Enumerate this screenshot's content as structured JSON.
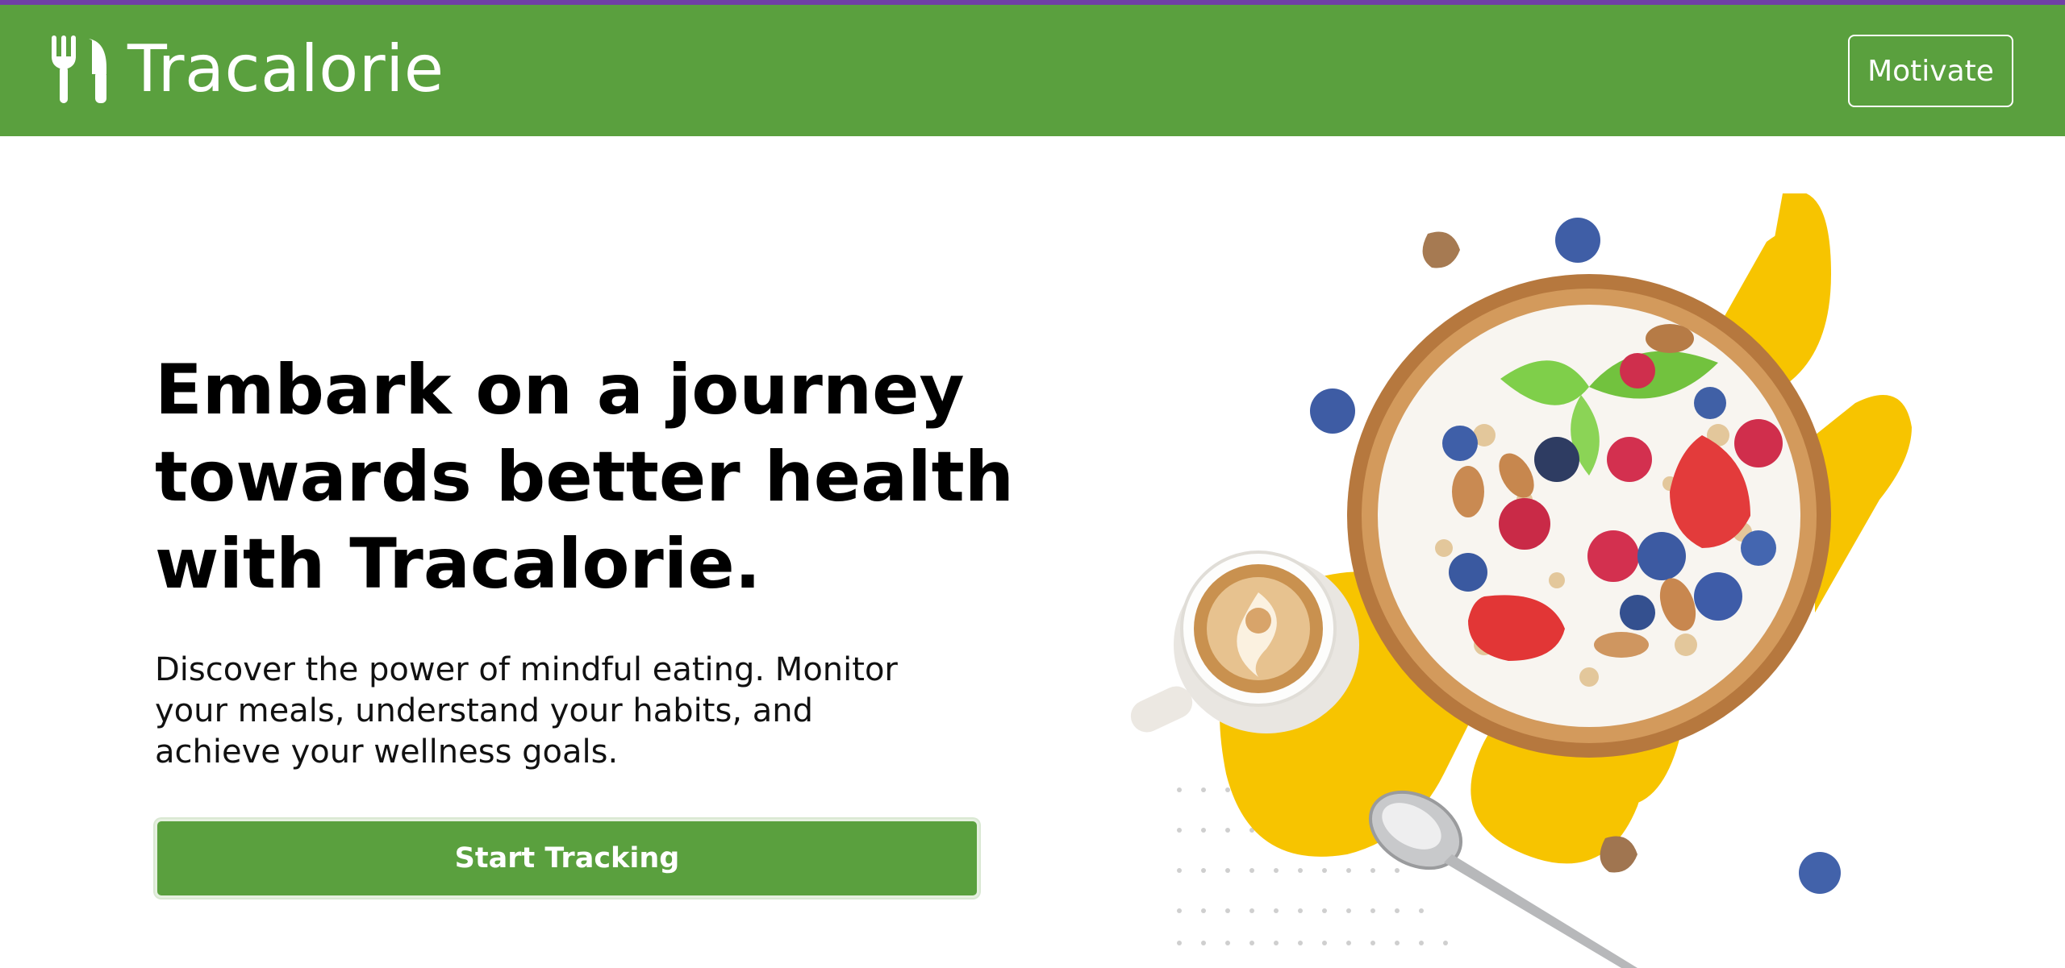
{
  "header": {
    "brand_name": "Tracalorie",
    "logo_icon": "utensils-icon",
    "motivate_label": "Motivate"
  },
  "hero": {
    "title_lines": [
      "Embark on a journey",
      "towards better health",
      "with Tracalorie."
    ],
    "subtitle_lines": [
      "Discover the power of mindful eating. Monitor",
      "your meals, understand your habits, and",
      "achieve your wellness goals."
    ],
    "cta_label": "Start Tracking",
    "image_icon": "breakfast-bowl-illustration"
  },
  "colors": {
    "brand_green": "#5aa03e",
    "top_accent": "#6f3fa6",
    "highlight_yellow": "#f7c400",
    "text": "#000000",
    "white": "#ffffff"
  }
}
